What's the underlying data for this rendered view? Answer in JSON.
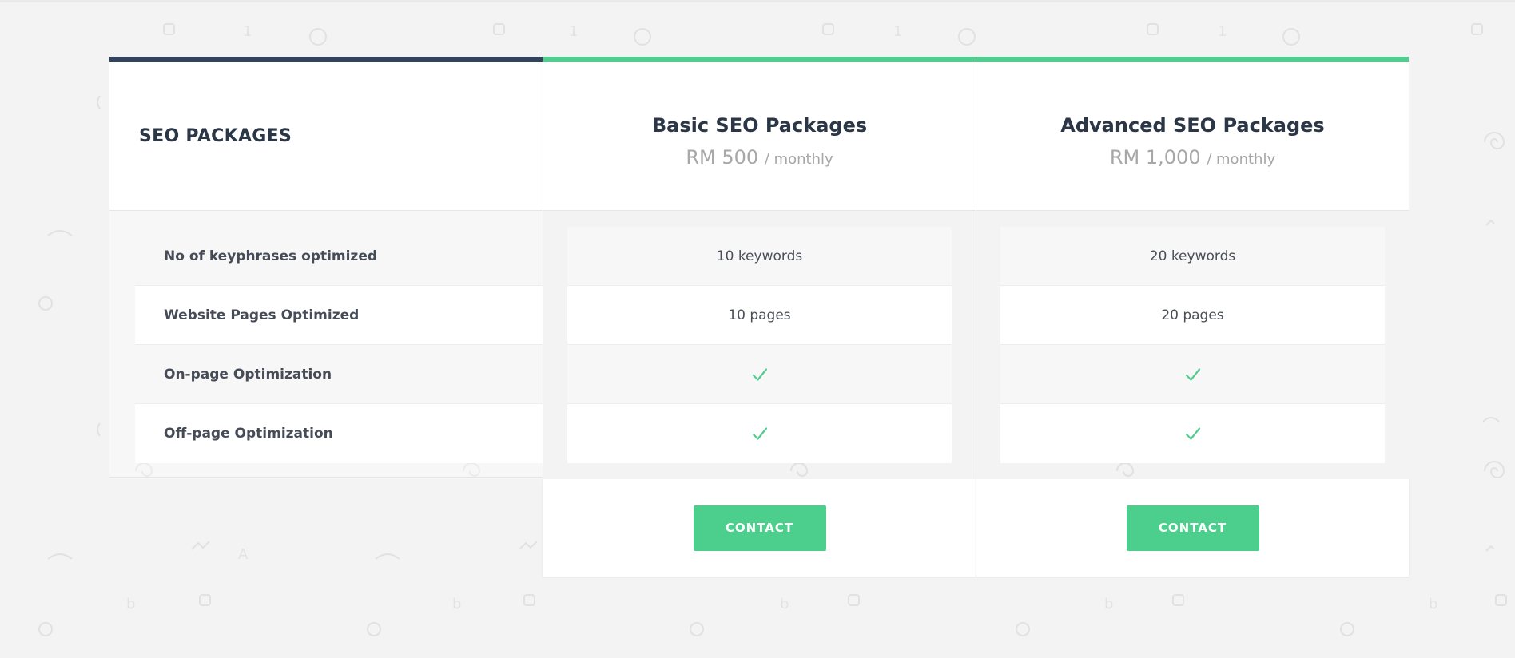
{
  "header": {
    "label": "SEO PACKAGES"
  },
  "plans": [
    {
      "name": "Basic SEO Packages",
      "price": "RM 500",
      "period": "/ monthly",
      "features": [
        "10 keywords",
        "10 pages",
        "check",
        "check"
      ],
      "button_label": "CONTACT"
    },
    {
      "name": "Advanced SEO Packages",
      "price": "RM 1,000",
      "period": "/ monthly",
      "features": [
        "20 keywords",
        "20 pages",
        "check",
        "check"
      ],
      "button_label": "CONTACT"
    }
  ],
  "features": [
    "No of keyphrases optimized",
    "Website Pages Optimized",
    "On-page Optimization",
    "Off-page Optimization"
  ],
  "colors": {
    "accent_green": "#52cc8f",
    "header_navy": "#33435c",
    "button_green": "#4ccf8d",
    "background": "#f3f3f3"
  },
  "icons": {
    "feature_included": "check-icon"
  }
}
